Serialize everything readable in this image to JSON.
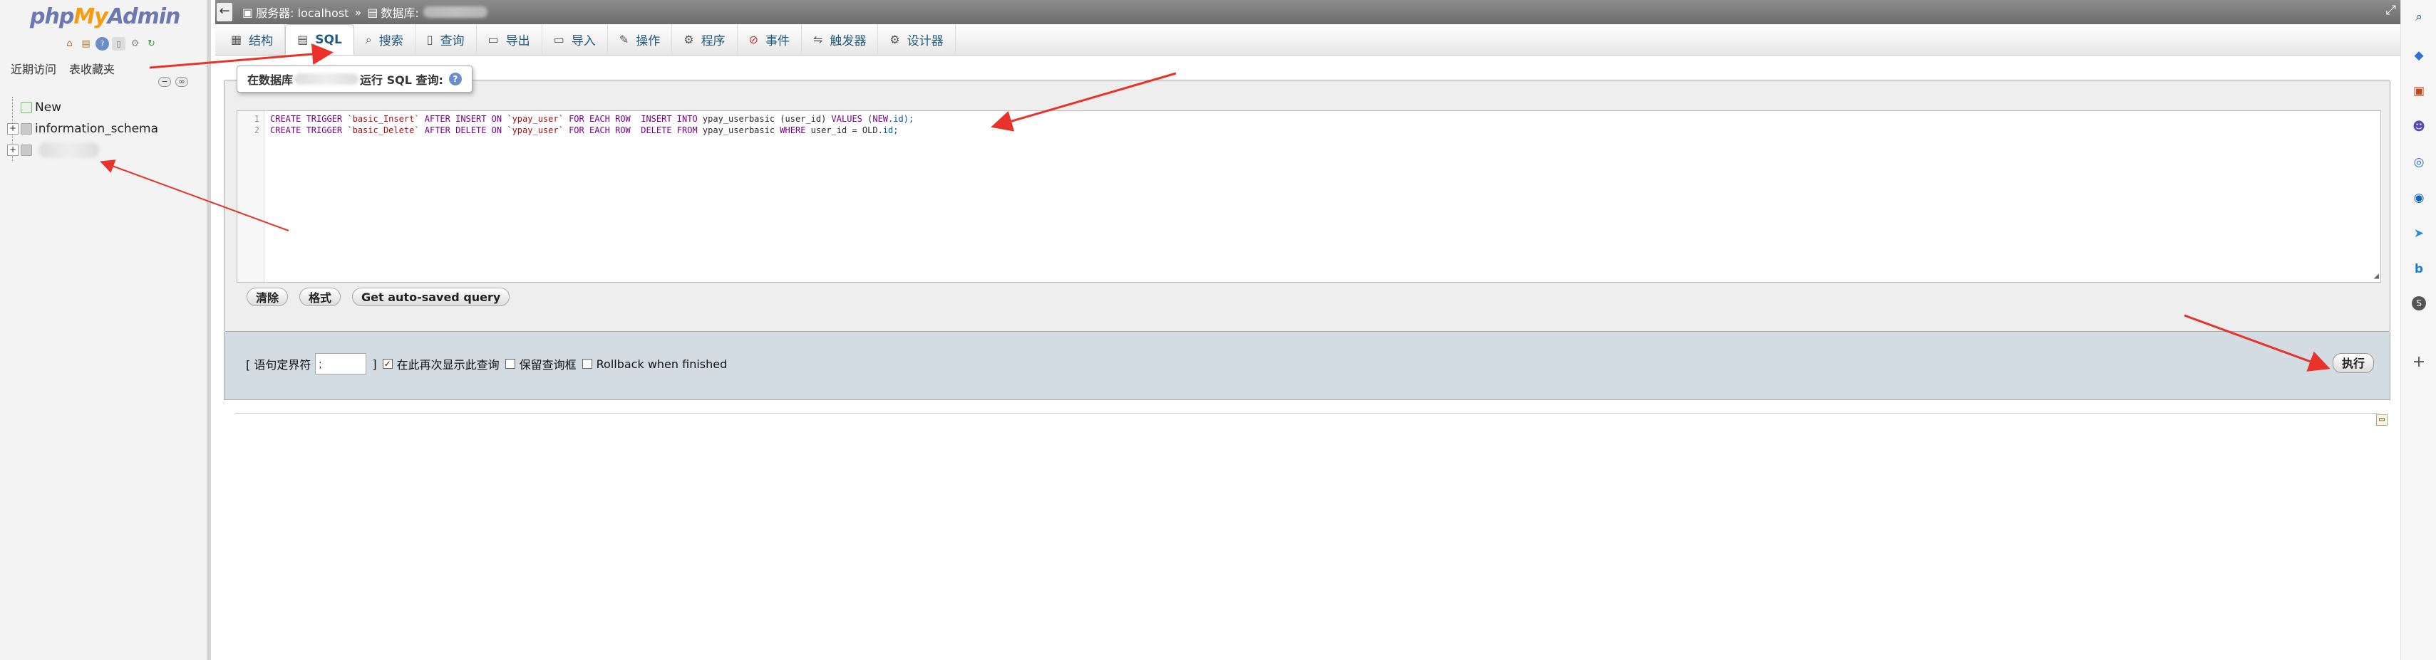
{
  "nav": {
    "logo": {
      "php": "php",
      "my": "My",
      "admin": "Admin"
    },
    "icons": [
      "home-icon",
      "database-icon",
      "help-icon",
      "docs-icon",
      "settings-icon",
      "reload-icon"
    ],
    "links": {
      "recent": "近期访问",
      "favorites": "表收藏夹"
    },
    "tree": [
      {
        "label": "New"
      },
      {
        "label": "information_schema"
      },
      {
        "label": ""
      }
    ]
  },
  "topbar": {
    "server_label": "服务器: localhost",
    "separator": "»",
    "db_label": "数据库: "
  },
  "tabs": [
    {
      "label": "结构",
      "icon": "structure-icon"
    },
    {
      "label": "SQL",
      "icon": "sql-icon",
      "active": true
    },
    {
      "label": "搜索",
      "icon": "search-icon"
    },
    {
      "label": "查询",
      "icon": "query-icon"
    },
    {
      "label": "导出",
      "icon": "export-icon"
    },
    {
      "label": "导入",
      "icon": "import-icon"
    },
    {
      "label": "操作",
      "icon": "operations-icon"
    },
    {
      "label": "程序",
      "icon": "routines-icon"
    },
    {
      "label": "事件",
      "icon": "events-icon"
    },
    {
      "label": "触发器",
      "icon": "triggers-icon"
    },
    {
      "label": "设计器",
      "icon": "designer-icon"
    }
  ],
  "sql_box": {
    "legend_prefix": "在数据库",
    "legend_suffix": "运行 SQL 查询:",
    "lines": [
      {
        "num": "1",
        "parts": [
          {
            "t": "CREATE TRIGGER ",
            "c": "kw"
          },
          {
            "t": "`basic_Insert`",
            "c": "str"
          },
          {
            "t": " AFTER INSERT ON ",
            "c": "kw"
          },
          {
            "t": "`ypay_user`",
            "c": "str"
          },
          {
            "t": " FOR EACH ROW  INSERT INTO ",
            "c": "kw"
          },
          {
            "t": "ypay_userbasic (user_id) ",
            "c": "id"
          },
          {
            "t": "VALUES ",
            "c": "kw"
          },
          {
            "t": "(",
            "c": "id"
          },
          {
            "t": "NEW",
            "c": "kw"
          },
          {
            "t": ".id);",
            "c": "vr"
          }
        ]
      },
      {
        "num": "2",
        "parts": [
          {
            "t": "CREATE TRIGGER ",
            "c": "kw"
          },
          {
            "t": "`basic_Delete`",
            "c": "str"
          },
          {
            "t": " AFTER DELETE ON ",
            "c": "kw"
          },
          {
            "t": "`ypay_user`",
            "c": "str"
          },
          {
            "t": " FOR EACH ROW  DELETE FROM ",
            "c": "kw"
          },
          {
            "t": "ypay_userbasic ",
            "c": "id"
          },
          {
            "t": "WHERE ",
            "c": "kw"
          },
          {
            "t": "user_id = OLD",
            "c": "id"
          },
          {
            "t": ".id;",
            "c": "vr"
          }
        ]
      }
    ],
    "buttons": {
      "clear": "清除",
      "format": "格式",
      "autosaved": "Get auto-saved query"
    }
  },
  "options": {
    "delimiter_label": "[ 语句定界符",
    "delimiter_value": ";",
    "delimiter_close": "]",
    "show_again": {
      "label": "在此再次显示此查询",
      "checked": true
    },
    "retain_box": {
      "label": "保留查询框",
      "checked": false
    },
    "rollback": {
      "label": "Rollback when finished",
      "checked": false
    },
    "go_label": "执行"
  },
  "right_bar_icons": [
    "search-icon",
    "tag-icon",
    "toolbox-icon",
    "person-icon",
    "office-icon",
    "outlook-icon",
    "send-icon",
    "bing-icon",
    "s-icon",
    "add-icon"
  ],
  "colors": {
    "arrow": "#e8322a",
    "tab_link": "#235a81",
    "options_bg": "#d3dce3"
  }
}
